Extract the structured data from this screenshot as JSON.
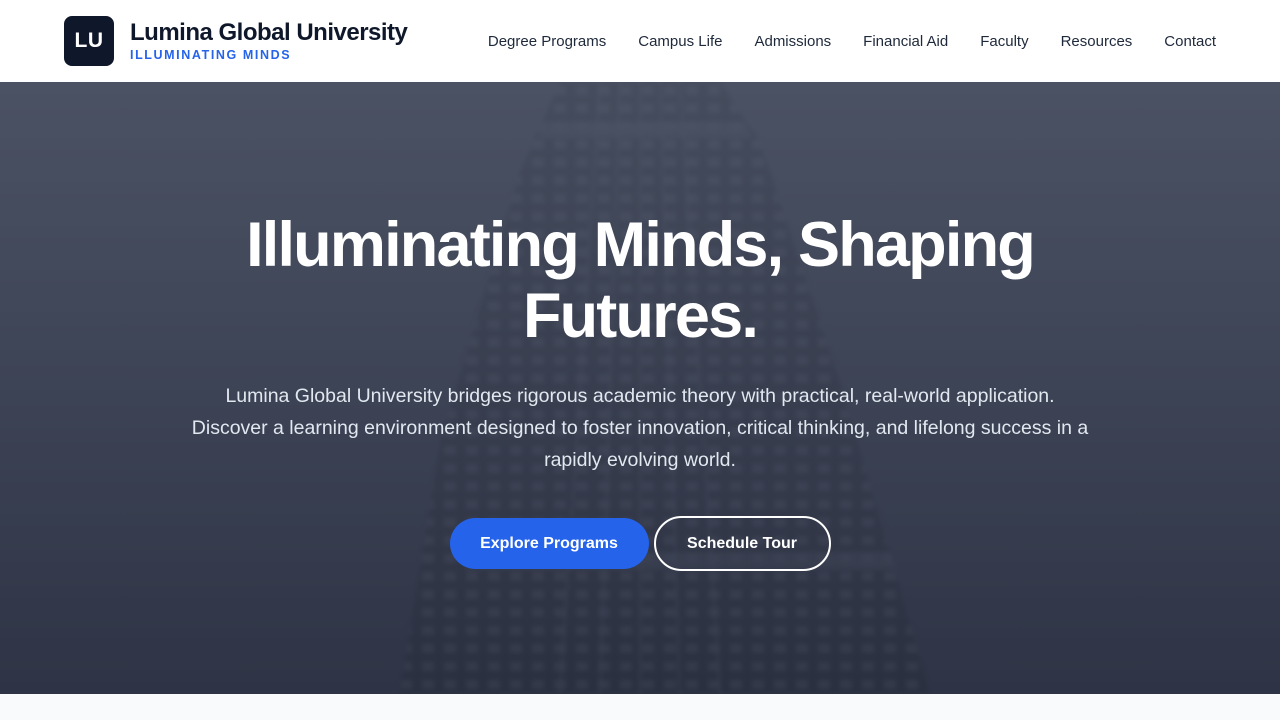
{
  "brand": {
    "logo_text": "LU",
    "name": "Lumina Global University",
    "tagline": "ILLUMINATING MINDS"
  },
  "nav": {
    "items": [
      {
        "label": "Degree Programs"
      },
      {
        "label": "Campus Life"
      },
      {
        "label": "Admissions"
      },
      {
        "label": "Financial Aid"
      },
      {
        "label": "Faculty"
      },
      {
        "label": "Resources"
      },
      {
        "label": "Contact"
      }
    ]
  },
  "hero": {
    "title": "Illuminating Minds, Shaping Futures.",
    "description": "Lumina Global University bridges rigorous academic theory with practical, real-world application. Discover a learning environment designed to foster innovation, critical thinking, and lifelong success in a rapidly evolving world.",
    "primary_button": "Explore Programs",
    "secondary_button": "Schedule Tour",
    "background_image": "flatiron-style-building-photo"
  },
  "colors": {
    "brand_dark": "#0f172a",
    "accent": "#2563eb",
    "header_bg": "#ffffff"
  }
}
